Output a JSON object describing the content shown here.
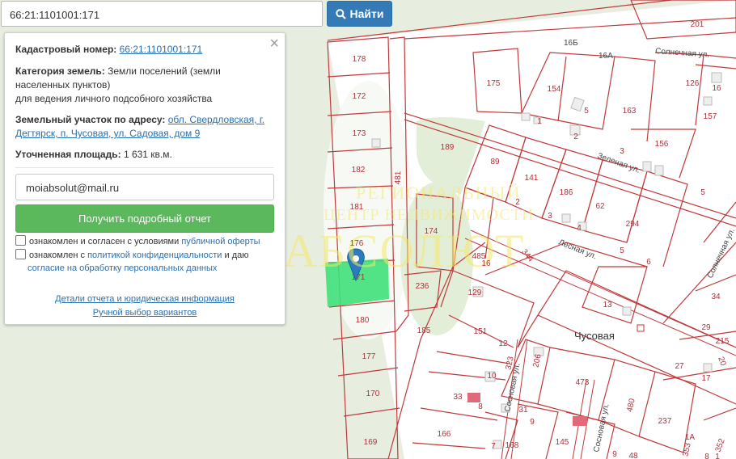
{
  "search": {
    "value": "66:21:1101001:171",
    "button_label": "Найти",
    "button_icon": "search-icon"
  },
  "panel": {
    "cadastral_label": "Кадастровый номер:",
    "cadastral_number": "66:21:1101001:171",
    "category_label": "Категория земель:",
    "category_value_1": "Земли поселений (земли",
    "category_value_2": "населенных пунктов)",
    "category_value_3": "для ведения личного подсобного хозяйства",
    "address_label": "Земельный участок по адресу:",
    "address_part_1": "обл. Свердловская, г.",
    "address_part_2": "Дегтярск, п. Чусовая, ул. Садовая, дом 9",
    "area_label": "Уточненная площадь:",
    "area_value": "1 631 кв.м.",
    "email_value": "moiabsolut@mail.ru",
    "report_button": "Получить подробный отчет",
    "check1_text": "ознакомлен и согласен с условиями",
    "check1_link": "публичной оферты",
    "check2_text": "ознакомлен с",
    "check2_link": "политикой конфиденциальности",
    "check2_tail": "и даю",
    "check2_link2": "согласие на обработку персональных данных",
    "details_link": "Детали отчета и юридическая информация",
    "manual_link": "Ручной выбор вариантов"
  },
  "watermark": {
    "line1": "РЕГИОНАЛЬНЫЙ",
    "line2": "ЦЕНТР НЕДВИЖИМОСТИ",
    "brand": "АБСОЛЮТ"
  },
  "map": {
    "parcels": [
      "178",
      "172",
      "173",
      "182",
      "181",
      "176",
      "171",
      "180",
      "177",
      "170",
      "169",
      "481",
      "174",
      "236",
      "185",
      "175",
      "154",
      "5",
      "163",
      "126",
      "16",
      "157",
      "189",
      "89",
      "141",
      "186",
      "62",
      "294",
      "156",
      "485",
      "16",
      "129",
      "151",
      "12",
      "10",
      "33",
      "8",
      "31",
      "9",
      "166",
      "7",
      "168",
      "145",
      "473",
      "206",
      "480",
      "237",
      "1A",
      "353",
      "352",
      "344",
      "13",
      "34",
      "29",
      "215",
      "27",
      "17",
      "20",
      "201",
      "3",
      "1",
      "2",
      "3",
      "3",
      "4",
      "5",
      "6",
      "5",
      "16",
      "9",
      "48",
      "1",
      "8",
      "323"
    ],
    "streets": [
      "16Б",
      "16А",
      "Солнечная ул.",
      "Зеленая ул.",
      "Лесная ул.",
      "Чусовая",
      "Сосновая ул.",
      "Солнечная ул.",
      "Сосновая ул."
    ],
    "colors": {
      "parcel_border": "#c0393b",
      "selected": "#3fe07a",
      "forest": "#e3efd9",
      "clearing": "#ffffff",
      "road": "#c0393b"
    }
  }
}
